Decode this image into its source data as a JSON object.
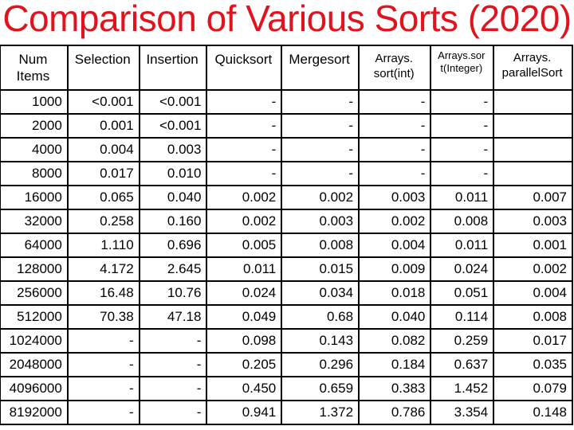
{
  "title": "Comparison of Various Sorts (2020)",
  "colors": {
    "title": "#e0141e",
    "text": "#000000",
    "border": "#000000",
    "background": "#ffffff"
  },
  "table": {
    "headers": [
      "Num Items",
      "Selection",
      "Insertion",
      "Quicksort",
      "Mergesort",
      "Arrays. sort(int)",
      "Arrays.sort(Integer)",
      "Arrays. parallelSort"
    ],
    "header_lines": [
      [
        "Num",
        "Items"
      ],
      [
        "Selection"
      ],
      [
        "Insertion"
      ],
      [
        "Quicksort"
      ],
      [
        "Mergesort"
      ],
      [
        "Arrays.",
        "sort(int)"
      ],
      [
        "Arrays.sor",
        "t(Integer)"
      ],
      [
        "Arrays.",
        "parallelSort"
      ]
    ],
    "rows": [
      [
        "1000",
        "<0.001",
        "<0.001",
        "-",
        "-",
        "-",
        "-",
        ""
      ],
      [
        "2000",
        "0.001",
        "<0.001",
        "-",
        "-",
        "-",
        "-",
        ""
      ],
      [
        "4000",
        "0.004",
        "0.003",
        "-",
        "-",
        "-",
        "-",
        ""
      ],
      [
        "8000",
        "0.017",
        "0.010",
        "-",
        "-",
        "-",
        "-",
        ""
      ],
      [
        "16000",
        "0.065",
        "0.040",
        "0.002",
        "0.002",
        "0.003",
        "0.011",
        "0.007"
      ],
      [
        "32000",
        "0.258",
        "0.160",
        "0.002",
        "0.003",
        "0.002",
        "0.008",
        "0.003"
      ],
      [
        "64000",
        "1.110",
        "0.696",
        "0.005",
        "0.008",
        "0.004",
        "0.011",
        "0.001"
      ],
      [
        "128000",
        "4.172",
        "2.645",
        "0.011",
        "0.015",
        "0.009",
        "0.024",
        "0.002"
      ],
      [
        "256000",
        "16.48",
        "10.76",
        "0.024",
        "0.034",
        "0.018",
        "0.051",
        "0.004"
      ],
      [
        "512000",
        "70.38",
        "47.18",
        "0.049",
        "0.68",
        "0.040",
        "0.114",
        "0.008"
      ],
      [
        "1024000",
        "-",
        "-",
        "0.098",
        "0.143",
        "0.082",
        "0.259",
        "0.017"
      ],
      [
        "2048000",
        "-",
        "-",
        "0.205",
        "0.296",
        "0.184",
        "0.637",
        "0.035"
      ],
      [
        "4096000",
        "-",
        "-",
        "0.450",
        "0.659",
        "0.383",
        "1.452",
        "0.079"
      ],
      [
        "8192000",
        "-",
        "-",
        "0.941",
        "1.372",
        "0.786",
        "3.354",
        "0.148"
      ]
    ]
  }
}
